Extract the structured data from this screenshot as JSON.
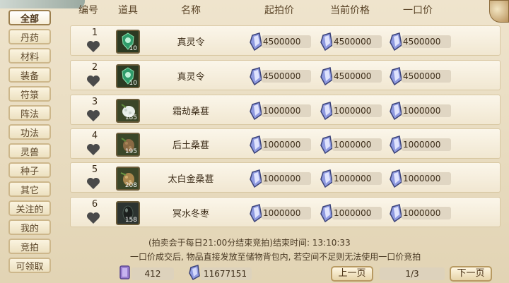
{
  "sidebar": {
    "items": [
      {
        "label": "全部",
        "active": true
      },
      {
        "label": "丹药"
      },
      {
        "label": "材料"
      },
      {
        "label": "装备"
      },
      {
        "label": "符箓"
      },
      {
        "label": "阵法"
      },
      {
        "label": "功法"
      },
      {
        "label": "灵兽"
      },
      {
        "label": "种子"
      },
      {
        "label": "其它"
      },
      {
        "label": "关注的"
      },
      {
        "label": "我的"
      },
      {
        "label": "竞拍"
      },
      {
        "label": "可领取"
      }
    ]
  },
  "table": {
    "headers": {
      "index": "编号",
      "item": "道具",
      "name": "名称",
      "start_price": "起拍价",
      "current_price": "当前价格",
      "buyout_price": "一口价"
    },
    "rows": [
      {
        "index": "1",
        "count": "10",
        "name": "真灵令",
        "start": "4500000",
        "current": "4500000",
        "buyout": "4500000",
        "icon": "token-icon"
      },
      {
        "index": "2",
        "count": "10",
        "name": "真灵令",
        "start": "4500000",
        "current": "4500000",
        "buyout": "4500000",
        "icon": "token-icon"
      },
      {
        "index": "3",
        "count": "185",
        "name": "霜劫桑葚",
        "start": "1000000",
        "current": "1000000",
        "buyout": "1000000",
        "icon": "white-mulberry-icon"
      },
      {
        "index": "4",
        "count": "195",
        "name": "后土桑葚",
        "start": "1000000",
        "current": "1000000",
        "buyout": "1000000",
        "icon": "brown-mulberry-icon"
      },
      {
        "index": "5",
        "count": "208",
        "name": "太白金桑葚",
        "start": "1000000",
        "current": "1000000",
        "buyout": "1000000",
        "icon": "gold-mulberry-icon"
      },
      {
        "index": "6",
        "count": "158",
        "name": "冥水冬枣",
        "start": "1000000",
        "current": "1000000",
        "buyout": "1000000",
        "icon": "dark-jujube-icon"
      }
    ]
  },
  "notice": {
    "line1": "(拍卖会于每日21:00分结束竞拍)结束时间: 13:10:33",
    "line2": "一口价成交后, 物品直接发放至储物背包内, 若空间不足则无法使用一口价竞拍"
  },
  "footer": {
    "currency1": "412",
    "currency2": "11677151",
    "prev_label": "上一页",
    "next_label": "下一页",
    "page": "1/3"
  },
  "colors": {
    "accent": "#9c7f4e",
    "gem": "#7a86c8"
  }
}
